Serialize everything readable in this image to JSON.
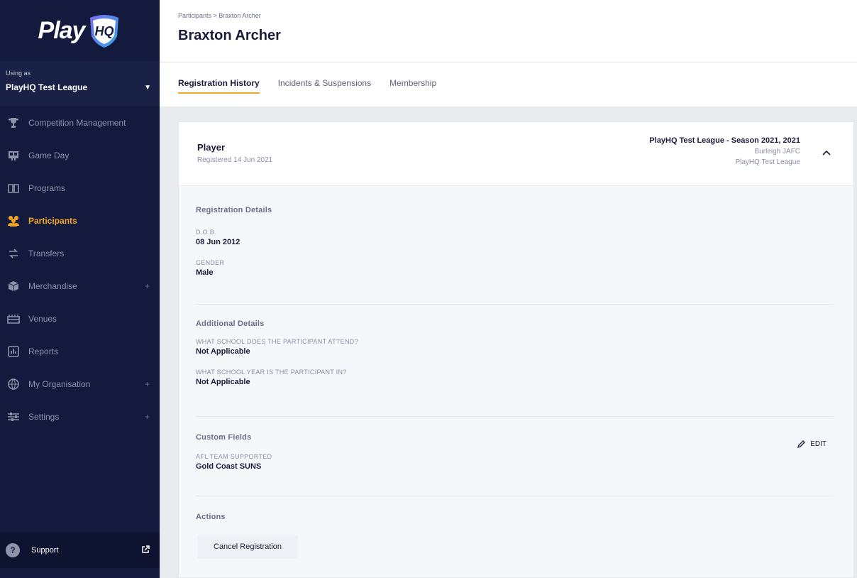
{
  "app": {
    "logo_text": "Play",
    "logo_badge": "HQ"
  },
  "sidebar": {
    "using_as_label": "Using as",
    "org_name": "PlayHQ Test League",
    "items": [
      {
        "label": "Competition Management",
        "icon": "trophy-icon"
      },
      {
        "label": "Game Day",
        "icon": "scoreboard-icon"
      },
      {
        "label": "Programs",
        "icon": "book-icon"
      },
      {
        "label": "Participants",
        "icon": "people-icon",
        "active": true
      },
      {
        "label": "Transfers",
        "icon": "transfer-icon"
      },
      {
        "label": "Merchandise",
        "icon": "box-icon",
        "expandable": true
      },
      {
        "label": "Venues",
        "icon": "stadium-icon"
      },
      {
        "label": "Reports",
        "icon": "reports-icon"
      },
      {
        "label": "My Organisation",
        "icon": "globe-icon",
        "expandable": true
      },
      {
        "label": "Settings",
        "icon": "sliders-icon",
        "expandable": true
      }
    ],
    "support_label": "Support"
  },
  "header": {
    "breadcrumb": "Participants > Braxton Archer",
    "title": "Braxton Archer"
  },
  "tabs": [
    {
      "label": "Registration History",
      "active": true
    },
    {
      "label": "Incidents & Suspensions"
    },
    {
      "label": "Membership"
    }
  ],
  "registration": {
    "role": "Player",
    "registered": "Registered 14 Jun 2021",
    "season": "PlayHQ Test League - Season 2021, 2021",
    "club": "Burleigh JAFC",
    "league": "PlayHQ Test League"
  },
  "details": {
    "title": "Registration Details",
    "dob_label": "D.O.B.",
    "dob_value": "08 Jun 2012",
    "gender_label": "GENDER",
    "gender_value": "Male"
  },
  "additional": {
    "title": "Additional Details",
    "q1_label": "WHAT SCHOOL DOES THE PARTICIPANT ATTEND?",
    "q1_value": "Not Applicable",
    "q2_label": "WHAT SCHOOL YEAR IS THE PARTICIPANT IN?",
    "q2_value": "Not Applicable"
  },
  "custom": {
    "title": "Custom Fields",
    "edit_label": "EDIT",
    "field_label": "AFL TEAM SUPPORTED",
    "field_value": "Gold Coast SUNS"
  },
  "actions": {
    "title": "Actions",
    "cancel_label": "Cancel Registration"
  },
  "colors": {
    "sidebar_bg": "#141a3d",
    "accent": "#f5a623",
    "logo_shield": "#5b5fd6"
  }
}
